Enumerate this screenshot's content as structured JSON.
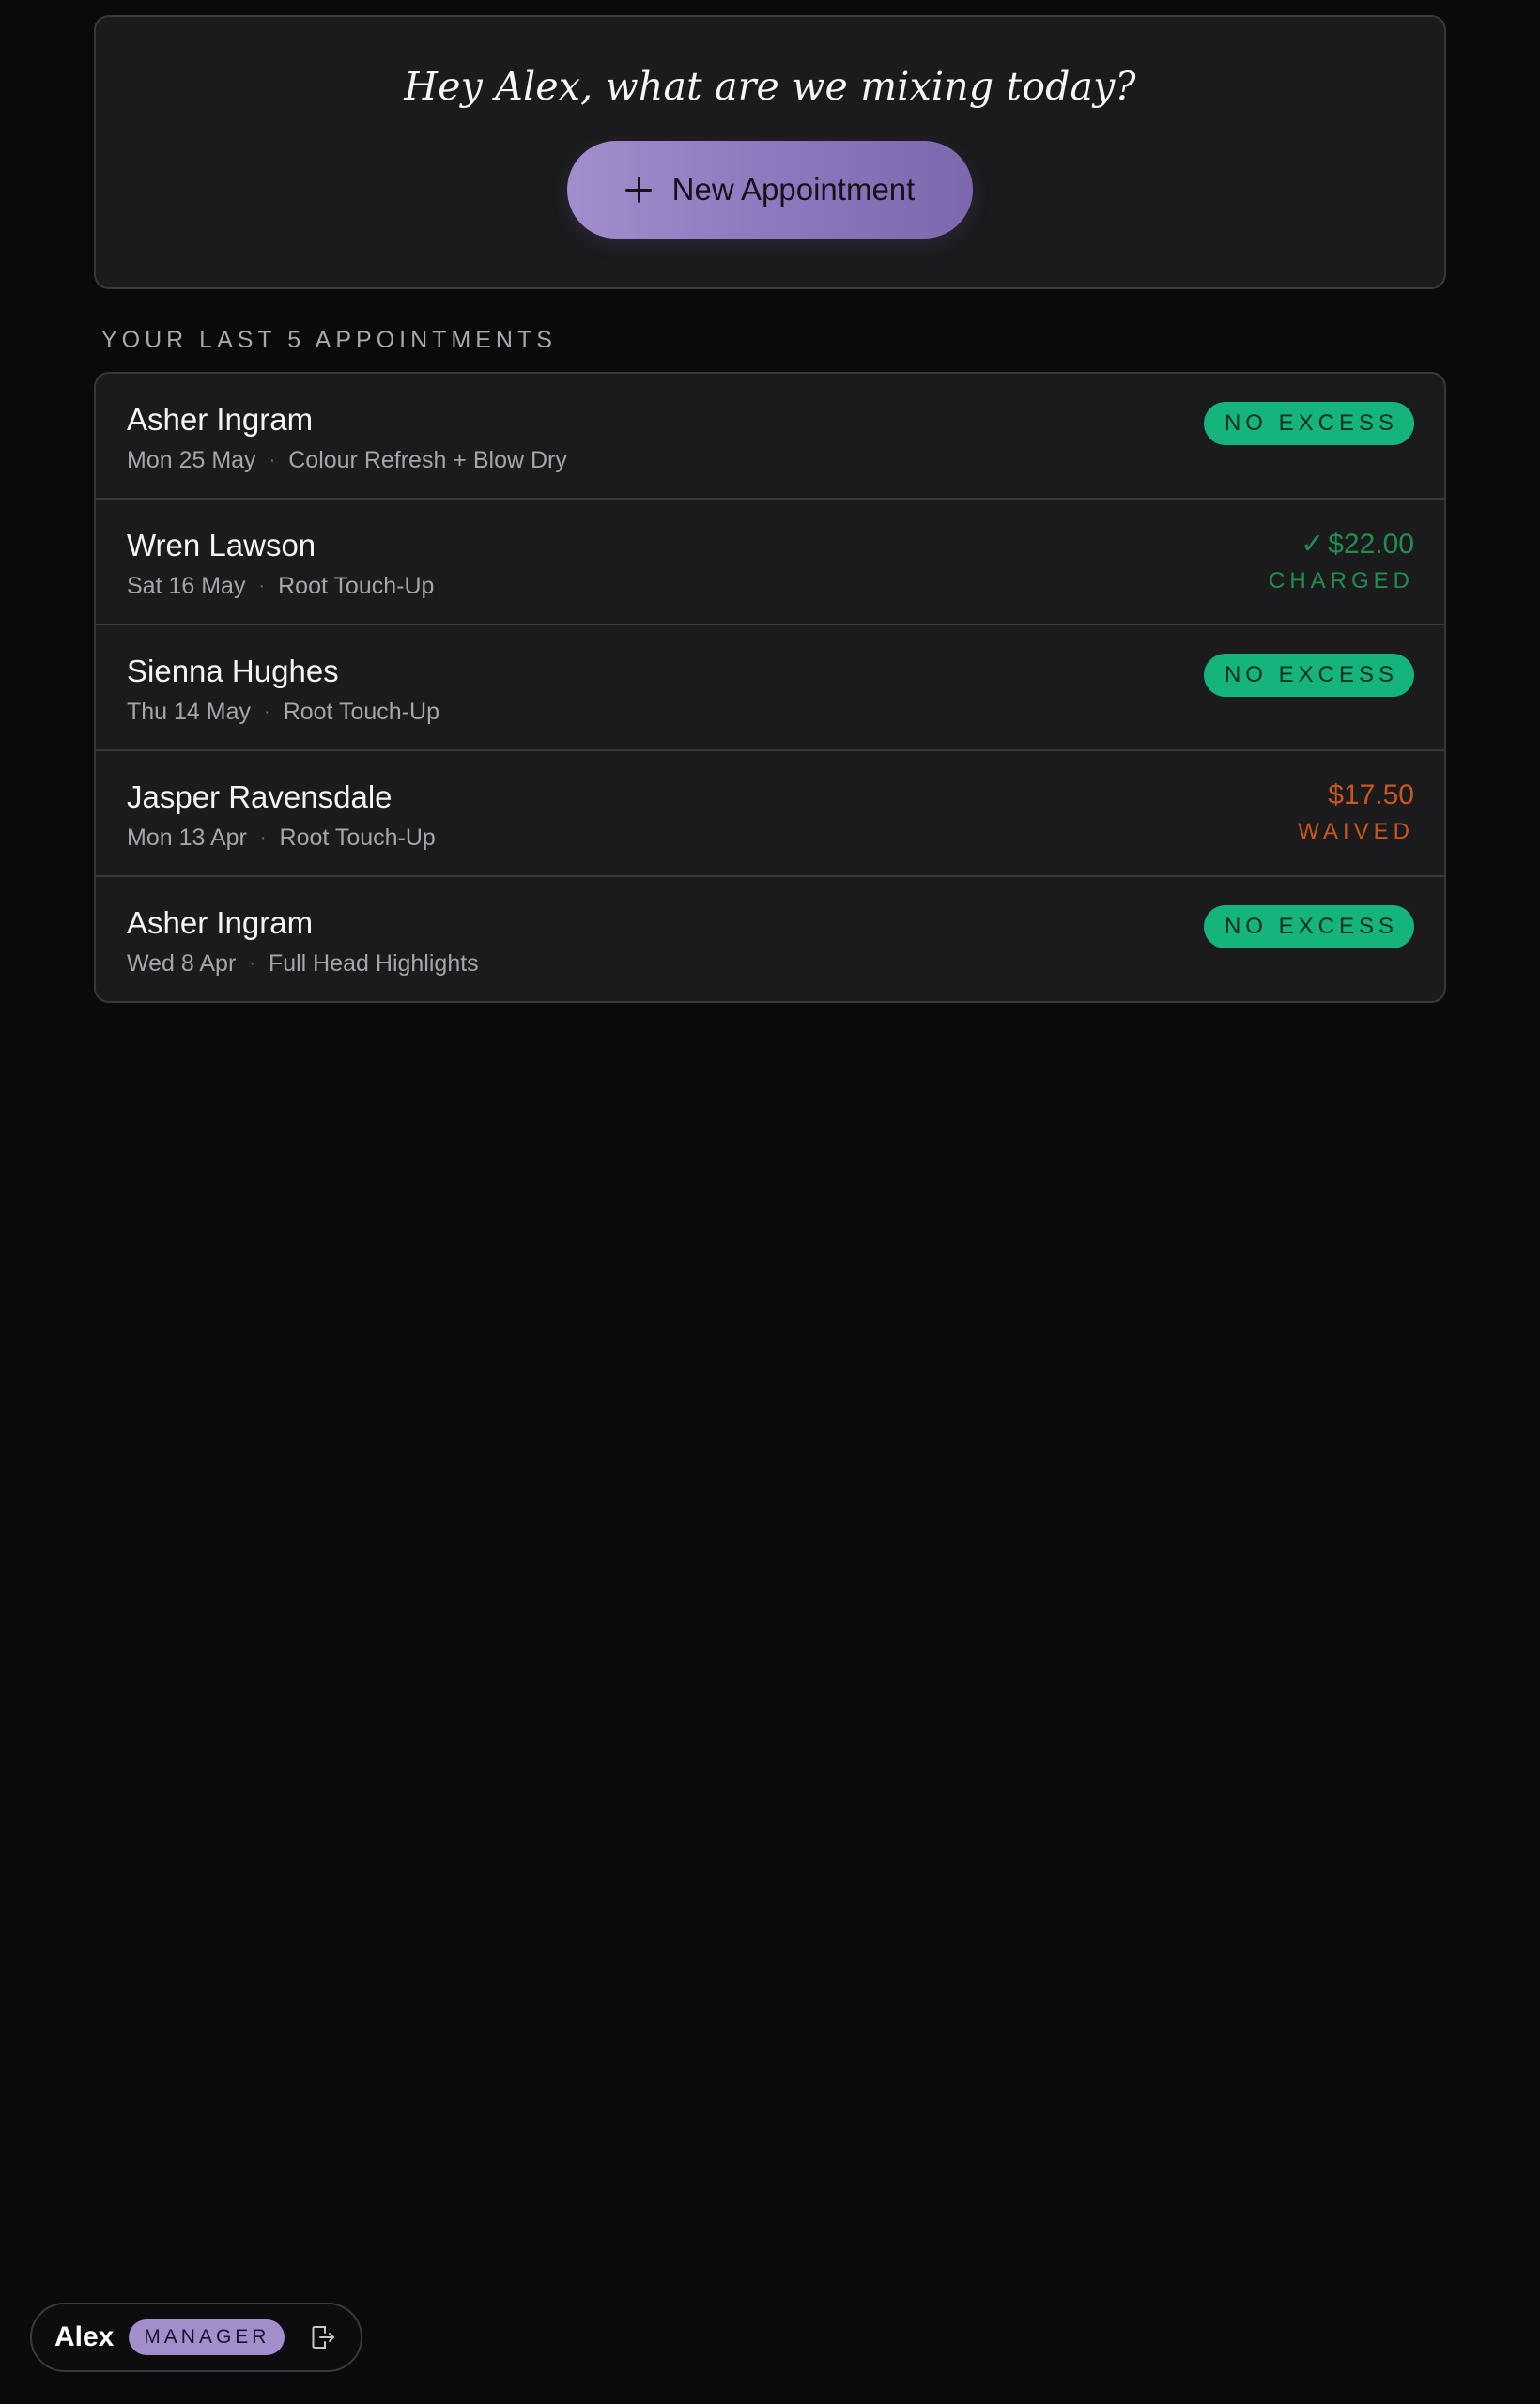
{
  "hero": {
    "greeting": "Hey Alex, what are we mixing today?",
    "new_appointment_label": "New Appointment"
  },
  "section_heading": "YOUR LAST 5 APPOINTMENTS",
  "appointments": [
    {
      "name": "Asher Ingram",
      "date": "Mon 25 May",
      "service": "Colour Refresh + Blow Dry",
      "status_label": "NO EXCESS"
    },
    {
      "name": "Wren Lawson",
      "date": "Sat 16 May",
      "service": "Root Touch-Up",
      "check": "✓",
      "amount": "$22.00",
      "status_label": "CHARGED"
    },
    {
      "name": "Sienna Hughes",
      "date": "Thu 14 May",
      "service": "Root Touch-Up",
      "status_label": "NO EXCESS"
    },
    {
      "name": "Jasper Ravensdale",
      "date": "Mon 13 Apr",
      "service": "Root Touch-Up",
      "amount": "$17.50",
      "status_label": "WAIVED"
    },
    {
      "name": "Asher Ingram",
      "date": "Wed 8 Apr",
      "service": "Full Head Highlights",
      "status_label": "NO EXCESS"
    }
  ],
  "separator": "·",
  "user": {
    "name": "Alex",
    "role": "MANAGER"
  },
  "icons": {
    "new_appointment": "plus-icon",
    "charged": "check-icon",
    "logout": "logout-icon"
  },
  "colors": {
    "background": "#0a0a0c",
    "card": "#1b1b1d",
    "accent": "#a18ecb",
    "no_excess": "#14b47c",
    "charged": "#1f8f4f",
    "waived": "#c9571c"
  }
}
